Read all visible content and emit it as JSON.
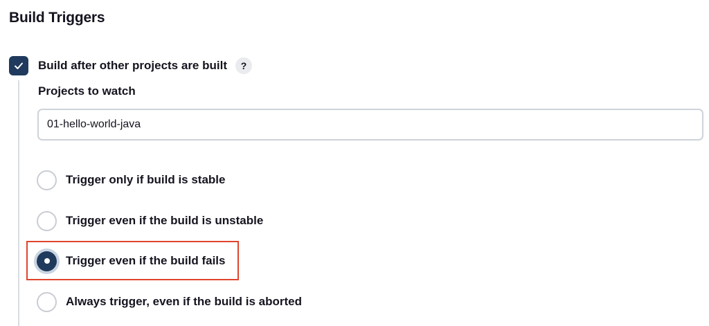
{
  "section": {
    "title": "Build Triggers"
  },
  "trigger_option": {
    "label": "Build after other projects are built",
    "checked": true,
    "help_glyph": "?",
    "check_icon": "check-icon"
  },
  "projects_field": {
    "label": "Projects to watch",
    "value": "01-hello-world-java"
  },
  "radio_options": [
    {
      "label": "Trigger only if build is stable",
      "selected": false
    },
    {
      "label": "Trigger even if the build is unstable",
      "selected": false
    },
    {
      "label": "Trigger even if the build fails",
      "selected": true
    },
    {
      "label": "Always trigger, even if the build is aborted",
      "selected": false
    }
  ],
  "colors": {
    "accent": "#1f3a5c",
    "highlight": "#e0442b"
  }
}
